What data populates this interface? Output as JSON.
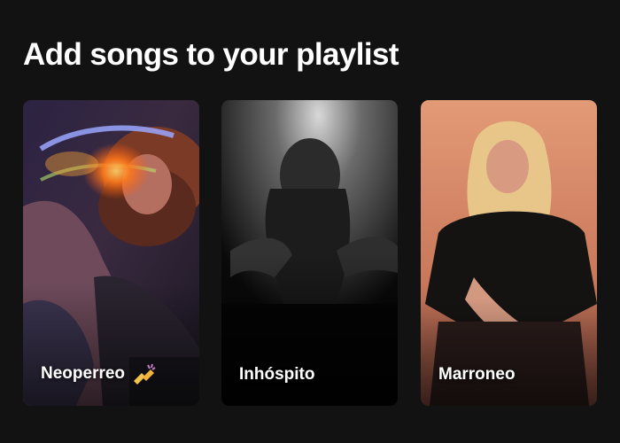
{
  "page": {
    "heading": "Add songs to your playlist"
  },
  "cards": [
    {
      "label": "Neoperreo",
      "emoji": "dancing-hands-emoji"
    },
    {
      "label": "Inhóspito"
    },
    {
      "label": "Marroneo"
    }
  ],
  "colors": {
    "background": "#121212",
    "text": "#ffffff",
    "card1_accent": "#f07a1a",
    "card3_tint": "#d88a66"
  }
}
